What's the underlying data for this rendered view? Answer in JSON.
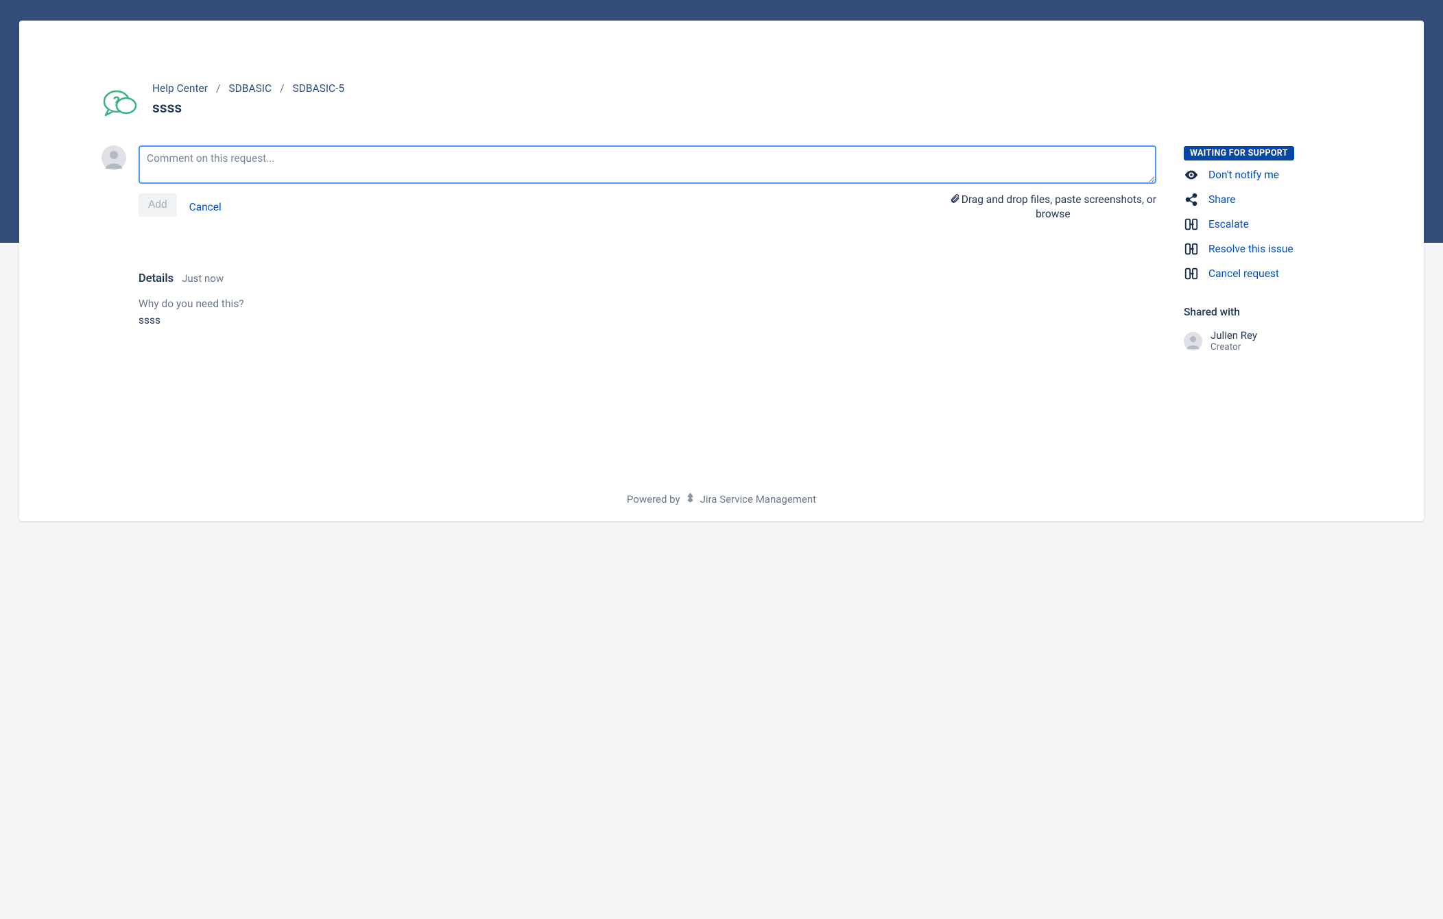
{
  "breadcrumb": {
    "items": [
      {
        "label": "Help Center"
      },
      {
        "label": "SDBASIC"
      },
      {
        "label": "SDBASIC-5"
      }
    ]
  },
  "title": "ssss",
  "comment": {
    "placeholder": "Comment on this request...",
    "add_label": "Add",
    "cancel_label": "Cancel",
    "dropzone_prefix": "Drag and drop files, paste screenshots, or",
    "dropzone_browse": "browse"
  },
  "details": {
    "heading": "Details",
    "time": "Just now",
    "field_label": "Why do you need this?",
    "field_value": "ssss"
  },
  "status": "WAITING FOR SUPPORT",
  "actions": {
    "notify": "Don't notify me",
    "share": "Share",
    "escalate": "Escalate",
    "resolve": "Resolve this issue",
    "cancel": "Cancel request"
  },
  "shared": {
    "heading": "Shared with",
    "person_name": "Julien Rey",
    "person_role": "Creator"
  },
  "footer": {
    "powered_by": "Powered by",
    "product": "Jira Service Management"
  }
}
